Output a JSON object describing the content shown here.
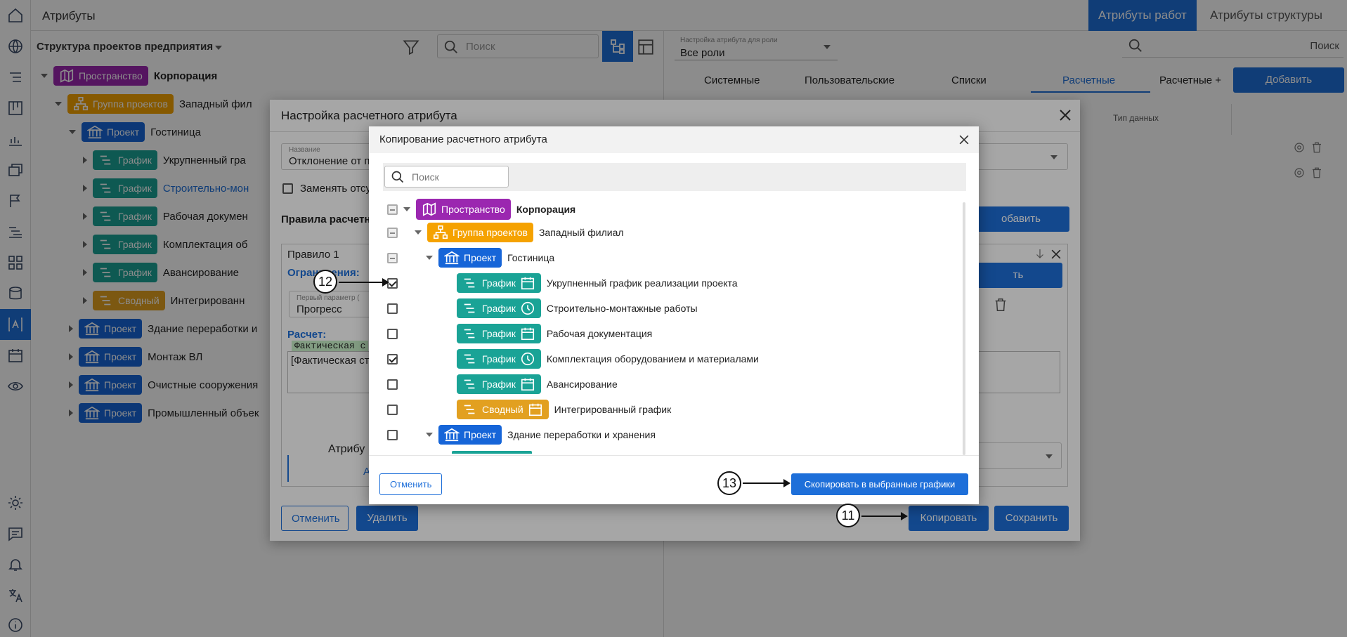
{
  "app": {
    "title": "Атрибуты",
    "tabs": [
      "Атрибуты работ",
      "Атрибуты структуры"
    ]
  },
  "left_panel": {
    "structure_select": "Структура проектов предприятия",
    "search_placeholder": "Поиск",
    "tree": [
      {
        "badge": "Пространство",
        "label": "Корпорация"
      },
      {
        "badge": "Группа проектов",
        "label": "Западный фил"
      },
      {
        "badge": "Проект",
        "label": "Гостиница"
      },
      {
        "badge": "График",
        "label": "Укрупненный гра"
      },
      {
        "badge": "График",
        "label": "Строительно-мон"
      },
      {
        "badge": "График",
        "label": "Рабочая докумен"
      },
      {
        "badge": "График",
        "label": "Комплектация об"
      },
      {
        "badge": "График",
        "label": "Авансирование"
      },
      {
        "badge": "Сводный",
        "label": "Интегрированн"
      },
      {
        "badge": "Проект",
        "label": "Здание переработки и"
      },
      {
        "badge": "Проект",
        "label": "Монтаж ВЛ"
      },
      {
        "badge": "Проект",
        "label": "Очистные сооружения"
      },
      {
        "badge": "Проект",
        "label": "Промышленный объек"
      }
    ]
  },
  "right_panel": {
    "role_label": "Настройка атрибута для роли",
    "role_value": "Все роли",
    "search_placeholder": "Поиск",
    "tabs": [
      "Системные",
      "Пользовательские",
      "Списки",
      "Расчетные",
      "Расчетные +"
    ],
    "add_button": "Добавить",
    "column_type": "Тип данных"
  },
  "dialog1": {
    "title": "Настройка расчетного атрибута",
    "name_label": "Название",
    "name_value": "Отклонение от п",
    "replace_label": "Заменять отсу",
    "rules_label": "Правила расчетн",
    "add_rule": "обавить правило",
    "rule_title": "Правило 1",
    "constraints_label": "Ограничения:",
    "add_constraint": "ть ограничение",
    "param_label": "Первый параметр (",
    "param_value": "Прогресс",
    "calc_label": "Расчет:",
    "calc_tag": "Фактическая с",
    "calc_text": "[Фактическая ст",
    "attr_label": "Атрибу",
    "attr_letter": "А",
    "cancel": "Отменить",
    "delete": "Удалить",
    "copy": "Копировать",
    "save": "Сохранить"
  },
  "dialog2": {
    "title": "Копирование расчетного атрибута",
    "search_placeholder": "Поиск",
    "rows": [
      {
        "state": "ind",
        "badge": "Пространство",
        "type": "space",
        "label": "Корпорация"
      },
      {
        "state": "ind",
        "badge": "Группа проектов",
        "type": "group",
        "label": "Западный филиал"
      },
      {
        "state": "ind",
        "badge": "Проект",
        "type": "project",
        "label": "Гостиница"
      },
      {
        "state": "on",
        "badge": "График",
        "type": "graph",
        "label": "Укрупненный график реализации проекта"
      },
      {
        "state": "off",
        "badge": "График",
        "type": "graph-clock",
        "label": "Строительно-монтажные работы"
      },
      {
        "state": "off",
        "badge": "График",
        "type": "graph",
        "label": "Рабочая документация"
      },
      {
        "state": "on",
        "badge": "График",
        "type": "graph-clock",
        "label": "Комплектация оборудованием и материалами"
      },
      {
        "state": "off",
        "badge": "График",
        "type": "graph",
        "label": "Авансирование"
      },
      {
        "state": "off",
        "badge": "Сводный",
        "type": "summary",
        "label": "Интегрированный график"
      },
      {
        "state": "off",
        "badge": "Проект",
        "type": "project",
        "label": "Здание переработки и хранения"
      }
    ],
    "cancel": "Отменить",
    "copy_selected": "Скопировать в выбранные графики"
  },
  "callouts": {
    "c12": "12",
    "c13": "13",
    "c11": "11"
  },
  "colors": {
    "primary": "#1e6fd9",
    "space": "#9b27b0",
    "group": "#f5a200",
    "project": "#1665d8",
    "graph": "#1aa396",
    "summary": "#e2a020"
  }
}
